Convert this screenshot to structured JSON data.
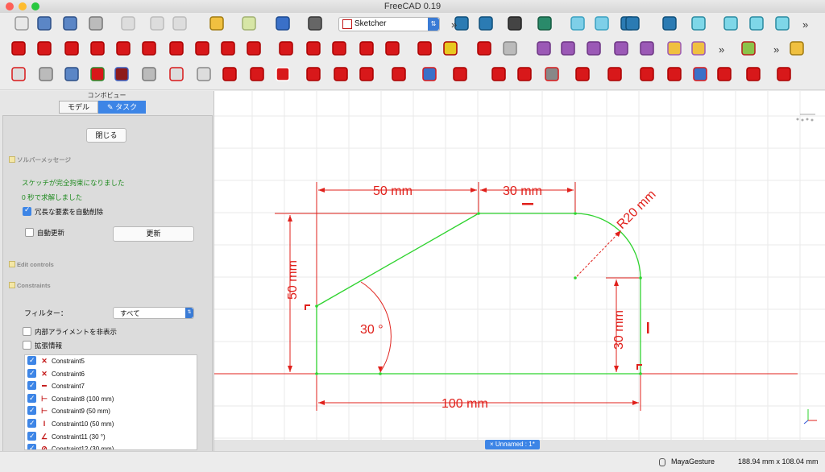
{
  "window": {
    "title": "FreeCAD 0.19"
  },
  "toolbar": {
    "workbench": "Sketcher"
  },
  "combo": {
    "title": "コンボビュー",
    "tabs": [
      {
        "label": "モデル"
      },
      {
        "label": "タスク"
      }
    ],
    "close_label": "閉じる",
    "solver_title": "ソルバーメッセージ",
    "solver_msg1": "スケッチが完全拘束になりました",
    "solver_msg2": "0 秒で求解しました",
    "auto_remove_label": "冗長な要素を自動削除",
    "auto_update_label": "自動更新",
    "update_label": "更新",
    "edit_controls": "Edit controls",
    "constraints_title": "Constraints",
    "filter_label": "フィルター：",
    "filter_value": "すべて",
    "hide_internal_label": "内部アライメントを非表示",
    "extended_label": "拡張情報",
    "constraints": [
      {
        "name": "Constraint5",
        "icon": "coincident-icon"
      },
      {
        "name": "Constraint6",
        "icon": "coincident-icon"
      },
      {
        "name": "Constraint7",
        "icon": "horizontal-icon"
      },
      {
        "name": "Constraint8 (100 mm)",
        "icon": "horizontal-distance-icon"
      },
      {
        "name": "Constraint9 (50 mm)",
        "icon": "horizontal-distance-icon"
      },
      {
        "name": "Constraint10 (50 mm)",
        "icon": "vertical-distance-icon"
      },
      {
        "name": "Constraint11 (30 °)",
        "icon": "angle-icon"
      },
      {
        "name": "Constraint12 (30 mm)",
        "icon": "distance-icon"
      }
    ]
  },
  "sketch": {
    "dim_top_left": "50 mm",
    "dim_top_right": "30 mm",
    "dim_radius": "R20 mm",
    "dim_left": "50 mm",
    "dim_angle": "30 °",
    "dim_right": "30 mm",
    "dim_bottom": "100 mm",
    "line_color": "#2fd32f",
    "constraint_color": "#e0201b"
  },
  "doc_tab": "× Unnamed : 1*",
  "status": {
    "user": "MayaGesture",
    "size": "188.94 mm x 108.04 mm"
  }
}
